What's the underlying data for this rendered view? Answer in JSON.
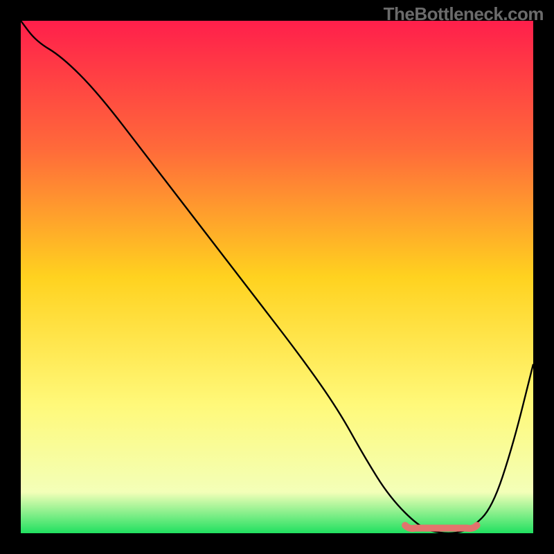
{
  "attribution": "TheBottleneck.com",
  "chart_data": {
    "type": "line",
    "title": "",
    "xlabel": "",
    "ylabel": "",
    "xlim": [
      0,
      100
    ],
    "ylim": [
      0,
      100
    ],
    "background_gradient": {
      "stops": [
        {
          "offset": 0,
          "color": "#ff1f4b"
        },
        {
          "offset": 25,
          "color": "#ff6a3a"
        },
        {
          "offset": 50,
          "color": "#ffd21f"
        },
        {
          "offset": 75,
          "color": "#fff97a"
        },
        {
          "offset": 92,
          "color": "#f3ffb8"
        },
        {
          "offset": 100,
          "color": "#20e060"
        }
      ]
    },
    "series": [
      {
        "name": "bottleneck-curve",
        "color": "#000000",
        "x": [
          0,
          3,
          8,
          15,
          25,
          35,
          45,
          55,
          62,
          67,
          72,
          78,
          82,
          85,
          88,
          92,
          96,
          100
        ],
        "y": [
          100,
          96,
          93,
          86,
          73,
          60,
          47,
          34,
          24,
          15,
          7,
          1,
          0,
          0,
          1,
          5,
          17,
          33
        ]
      }
    ],
    "highlight_band": {
      "name": "optimal-zone",
      "color": "#e2746d",
      "x_start": 75,
      "x_end": 89,
      "y": 1
    }
  }
}
